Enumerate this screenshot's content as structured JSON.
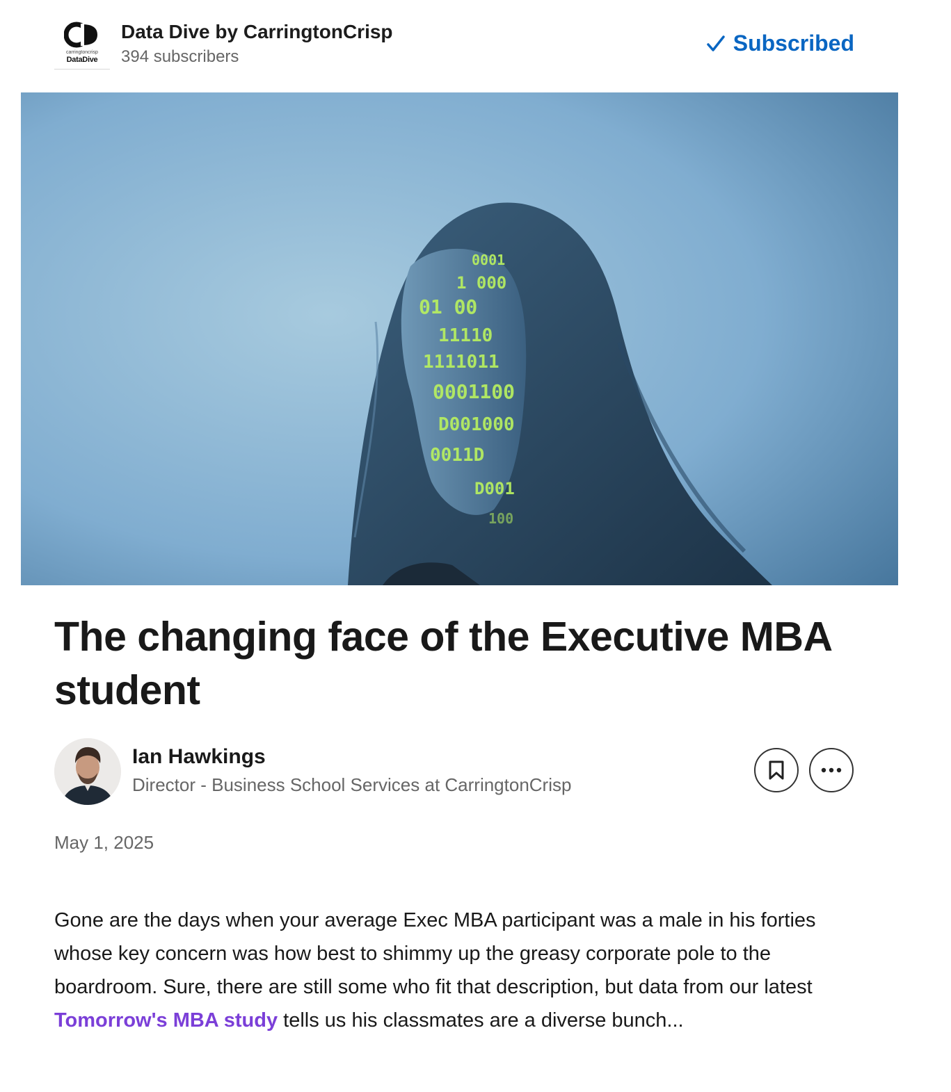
{
  "header": {
    "logo_small_text": "carringtoncrisp",
    "logo_brand_text": "DataDive",
    "newsletter_name": "Data Dive by CarringtonCrisp",
    "subscriber_count": "394 subscribers",
    "subscribed_label": "Subscribed"
  },
  "hero": {
    "projection_rows": [
      "0001",
      "1 000",
      "01 00",
      "11110",
      "1111011",
      "0001100",
      "D001000",
      "0011D",
      "D001",
      "100"
    ]
  },
  "article": {
    "title": "The changing face of the Executive MBA student",
    "author_name": "Ian Hawkings",
    "author_title": "Director - Business School Services at CarringtonCrisp",
    "date": "May 1, 2025",
    "body_before_link": "Gone are the days when your average Exec MBA participant was a male in his forties whose key concern was how best to shimmy up the greasy corporate pole to the boardroom. Sure, there are still some who fit that description, but data from our latest ",
    "link_text": "Tomorrow's MBA study",
    "body_after_link": " tells us his classmates are a diverse bunch..."
  },
  "colors": {
    "accent": "#0a66c2",
    "link": "#7b3fd8",
    "projection": "#b8f060"
  },
  "icons": {
    "subscribed": "checkmark-icon",
    "save": "bookmark-icon",
    "more": "ellipsis-icon"
  }
}
